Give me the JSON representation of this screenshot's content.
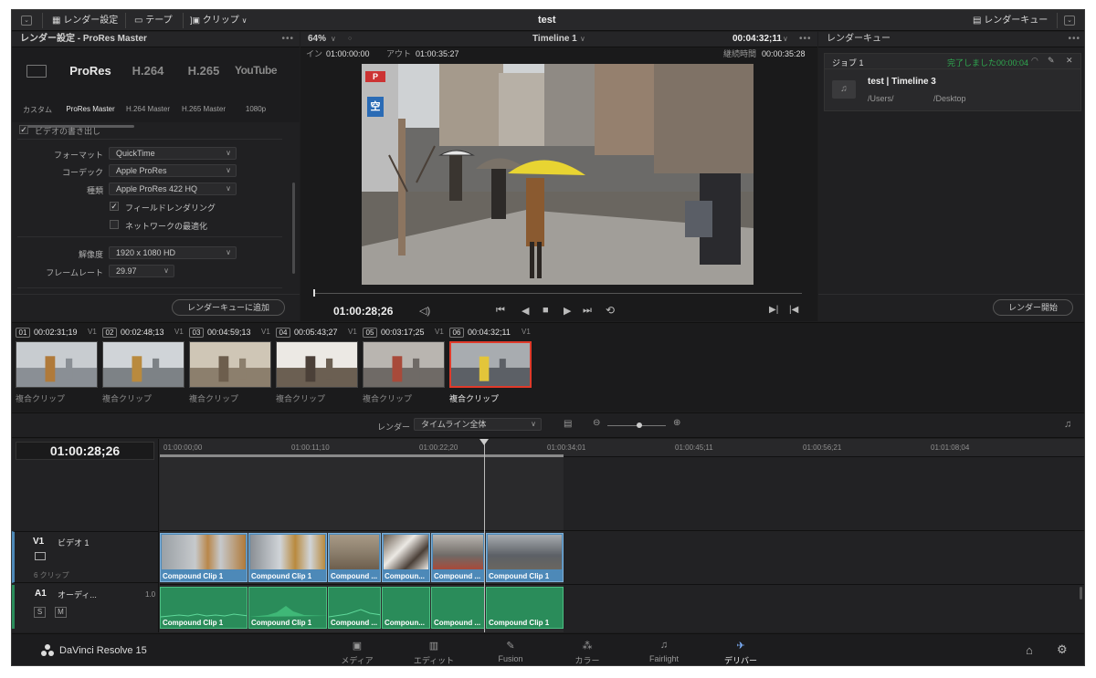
{
  "window_title": "test",
  "topbar": {
    "menu_icon": "chevron-down-icon",
    "render_settings_label": "レンダー設定",
    "tape_label": "テープ",
    "clip_label": "クリップ",
    "render_queue_label": "レンダーキュー"
  },
  "left_panel": {
    "title": "レンダー設定 - ProRes Master",
    "formats": [
      {
        "icon": "film-icon",
        "big": "",
        "label": "カスタム"
      },
      {
        "big": "ProRes",
        "label": "ProRes Master"
      },
      {
        "big": "H.264",
        "label": "H.264 Master"
      },
      {
        "big": "H.265",
        "label": "H.265 Master"
      },
      {
        "big": "YouTube",
        "label": "1080p"
      }
    ],
    "export_video_label": "ビデオの書き出し",
    "format_label": "フォーマット",
    "format_value": "QuickTime",
    "codec_label": "コーデック",
    "codec_value": "Apple ProRes",
    "type_label": "種類",
    "type_value": "Apple ProRes 422 HQ",
    "field_render_label": "フィールドレンダリング",
    "network_opt_label": "ネットワークの最適化",
    "resolution_label": "解像度",
    "resolution_value": "1920 x 1080 HD",
    "framerate_label": "フレームレート",
    "framerate_value": "29.97",
    "add_queue_button": "レンダーキューに追加"
  },
  "viewer": {
    "zoom": "64%",
    "timeline_name": "Timeline 1",
    "duration_tc": "00:04:32;11",
    "in_label": "イン",
    "in_tc": "01:00:00:00",
    "out_label": "アウト",
    "out_tc": "01:00:35:27",
    "elapsed_label": "継続時間",
    "elapsed_tc": "00:00:35:28",
    "current_tc": "01:00:28;26",
    "sign_letter": "空",
    "sign_p": "P"
  },
  "render_queue": {
    "title": "レンダーキュー",
    "job_label": "ジョブ 1",
    "job_status": "完了しました00:00:04",
    "job_title": "test | Timeline 3",
    "job_path_1": "/Users/",
    "job_path_2": "/Desktop",
    "start_button": "レンダー開始"
  },
  "clips": [
    {
      "num": "01",
      "tc": "00:02:31;19",
      "track": "V1",
      "caption": "複合クリップ",
      "colors": [
        "#8a8f95",
        "#c8ccd0",
        "#b07a3a"
      ]
    },
    {
      "num": "02",
      "tc": "00:02:48;13",
      "track": "V1",
      "caption": "複合クリップ",
      "colors": [
        "#7d8286",
        "#d0d4d8",
        "#b98a3e"
      ]
    },
    {
      "num": "03",
      "tc": "00:04:59;13",
      "track": "V1",
      "caption": "複合クリップ",
      "colors": [
        "#8c7f6d",
        "#cfc6b6",
        "#6d5e4d"
      ]
    },
    {
      "num": "04",
      "tc": "00:05:43;27",
      "track": "V1",
      "caption": "複合クリップ",
      "colors": [
        "#6b5f52",
        "#ece9e4",
        "#4b4038"
      ]
    },
    {
      "num": "05",
      "tc": "00:03:17;25",
      "track": "V1",
      "caption": "複合クリップ",
      "colors": [
        "#6f6a66",
        "#b9b5b0",
        "#a84a3a"
      ]
    },
    {
      "num": "06",
      "tc": "00:04:32;11",
      "track": "V1",
      "caption": "複合クリップ",
      "colors": [
        "#5c6066",
        "#a8acb0",
        "#e3c53a"
      ]
    }
  ],
  "render_bar": {
    "render_label": "レンダー",
    "render_value": "タイムライン全体"
  },
  "timeline": {
    "current_tc": "01:00:28;26",
    "ruler": [
      "01:00:00;00",
      "01:00:11;10",
      "01:00:22;20",
      "01:00:34;01",
      "01:00:45;11",
      "01:00:56;21",
      "01:01:08;04"
    ],
    "v1_label": "V1",
    "v1_name": "ビデオ 1",
    "v1_count": "6 クリップ",
    "a1_label": "A1",
    "a1_name": "オーディ...",
    "a1_level": "1.0",
    "a1_s": "S",
    "a1_m": "M",
    "video_clips": [
      "Compound Clip 1",
      "Compound Clip 1",
      "Compound ...",
      "Compoun...",
      "Compound ...",
      "Compound Clip 1"
    ],
    "audio_clips": [
      "Compound Clip 1",
      "Compound Clip 1",
      "Compound ...",
      "Compoun...",
      "Compound ...",
      "Compound Clip 1"
    ]
  },
  "bottom": {
    "app_name": "DaVinci Resolve 15",
    "pages": [
      {
        "icon": "media-icon",
        "label": "メディア"
      },
      {
        "icon": "edit-icon",
        "label": "エディット"
      },
      {
        "icon": "fusion-icon",
        "label": "Fusion"
      },
      {
        "icon": "color-icon",
        "label": "カラー"
      },
      {
        "icon": "fairlight-icon",
        "label": "Fairlight"
      },
      {
        "icon": "deliver-icon",
        "label": "デリバー"
      }
    ]
  },
  "colors": {
    "accent_red": "#e03a2a",
    "video_clip": "#4d89b8",
    "audio_clip": "#2a8c5a",
    "status_green": "#2fa84f"
  }
}
